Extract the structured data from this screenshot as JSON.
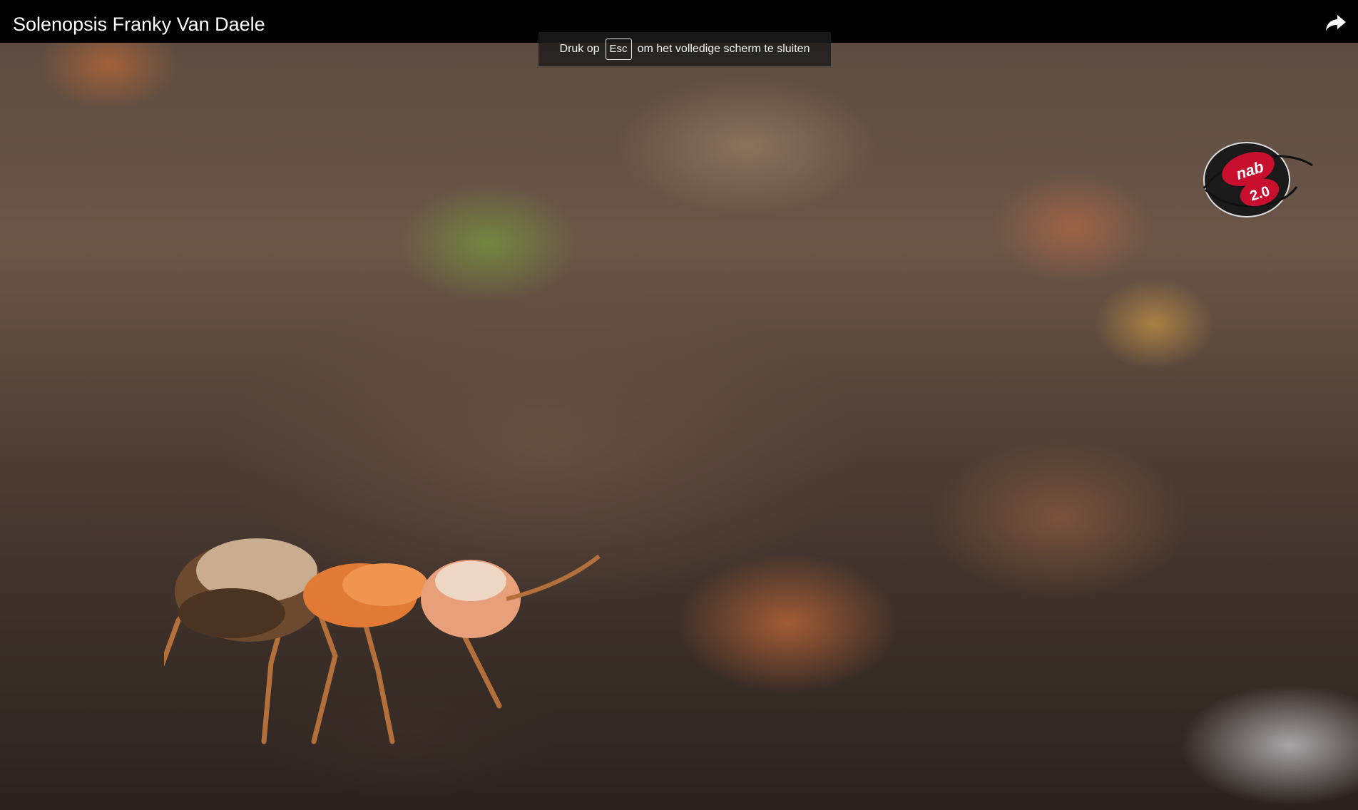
{
  "video": {
    "title": "Solenopsis Franky Van Daele"
  },
  "fullscreen_hint": {
    "text_before": "Druk op",
    "key": "Esc",
    "text_after": "om het volledige scherm te sluiten"
  },
  "watermark": {
    "line1": "nab",
    "line2": "2.0"
  },
  "icons": {
    "share": "share-icon"
  },
  "colors": {
    "title_bar": "#000000",
    "title_text": "#ffffff",
    "watermark_red": "#c8102e"
  }
}
